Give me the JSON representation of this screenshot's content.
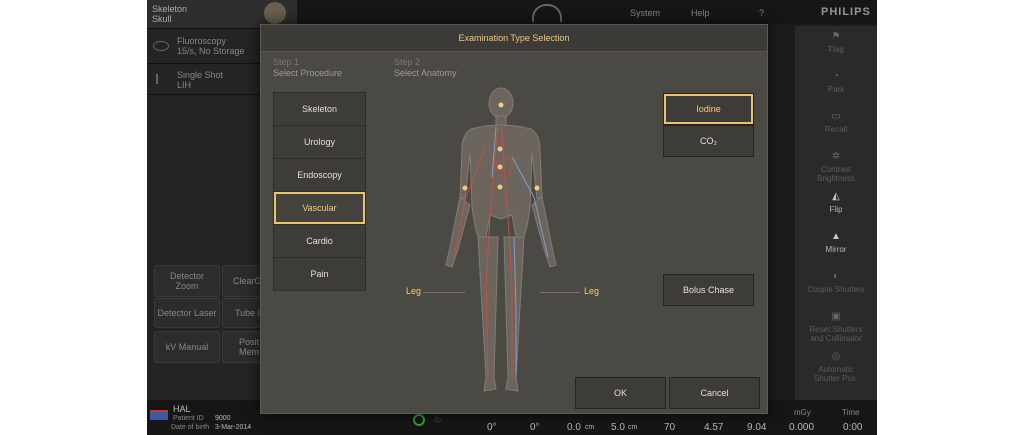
{
  "left_panel": {
    "header_line1": "Skeleton",
    "header_line2": "Skull",
    "fluoro_line1": "Fluoroscopy",
    "fluoro_line2": "15/s, No Storage",
    "shot_line1": "Single Shot",
    "shot_line2": "LIH",
    "detector_zoom": "Detector",
    "detector_zoom2": "Zoom",
    "clear": "ClearG",
    "detector_laser": "Detector Laser",
    "tube": "Tube I",
    "kv_manual": "kV Manual",
    "position_mem1": "Posit",
    "position_mem2": "Mem"
  },
  "top_bar": {
    "system": "System",
    "help": "Help",
    "question": "?",
    "brand": "PHILIPS"
  },
  "right_panel": {
    "items": [
      {
        "label": "Flag",
        "label2": "",
        "icon": "flag-icon",
        "active": false
      },
      {
        "label": "Park",
        "label2": "",
        "icon": "park-icon",
        "active": false
      },
      {
        "label": "Recall",
        "label2": "",
        "icon": "recall-icon",
        "active": false
      },
      {
        "label": "Contrast",
        "label2": "Brightness",
        "icon": "contrast-icon",
        "active": false
      },
      {
        "label": "Flip",
        "label2": "",
        "icon": "flip-icon",
        "active": true
      },
      {
        "label": "Mirror",
        "label2": "",
        "icon": "mirror-icon",
        "active": true
      },
      {
        "label": "Couple Shutters",
        "label2": "",
        "icon": "shutter-icon",
        "active": false
      },
      {
        "label": "Reset Shutters",
        "label2": "and Collimator",
        "icon": "reset-icon",
        "active": false
      },
      {
        "label": "Automatic",
        "label2": "Shutter Pos.",
        "icon": "auto-shutter-icon",
        "active": false
      }
    ]
  },
  "bottom_bar": {
    "patient_name": "HAL",
    "patient_id_label": "Patient ID",
    "patient_id": "9000",
    "dob_label": "Date of birth",
    "dob": "3-Mar-2014",
    "angle1": "0°",
    "angle2": "0°",
    "dist1": "0.0",
    "dist1_unit": "cm",
    "dist2": "5.0",
    "dist2_unit": "cm",
    "v1": "70",
    "v2": "4.57",
    "v3": "9.04",
    "dose_label": "mGy",
    "dose": "0.000",
    "time_label": "Time",
    "time": "0:00"
  },
  "modal": {
    "title": "Examination Type Selection",
    "step1_label": "Step 1",
    "step1_title": "Select Procedure",
    "step2_label": "Step 2",
    "step2_title": "Select Anatomy",
    "procedures": [
      "Skeleton",
      "Urology",
      "Endoscopy",
      "Vascular",
      "Cardio",
      "Pain"
    ],
    "selected_procedure": "Vascular",
    "agents": [
      "Iodine",
      "CO₂"
    ],
    "selected_agent": "Iodine",
    "leg_left": "Leg",
    "leg_right": "Leg",
    "bolus_chase": "Bolus Chase",
    "ok": "OK",
    "cancel": "Cancel"
  },
  "colors": {
    "accent": "#e9c46a",
    "accent_text": "#f2cb7c",
    "modal_bg": "#4b4944",
    "screen_bg": "#1c1c1c"
  }
}
